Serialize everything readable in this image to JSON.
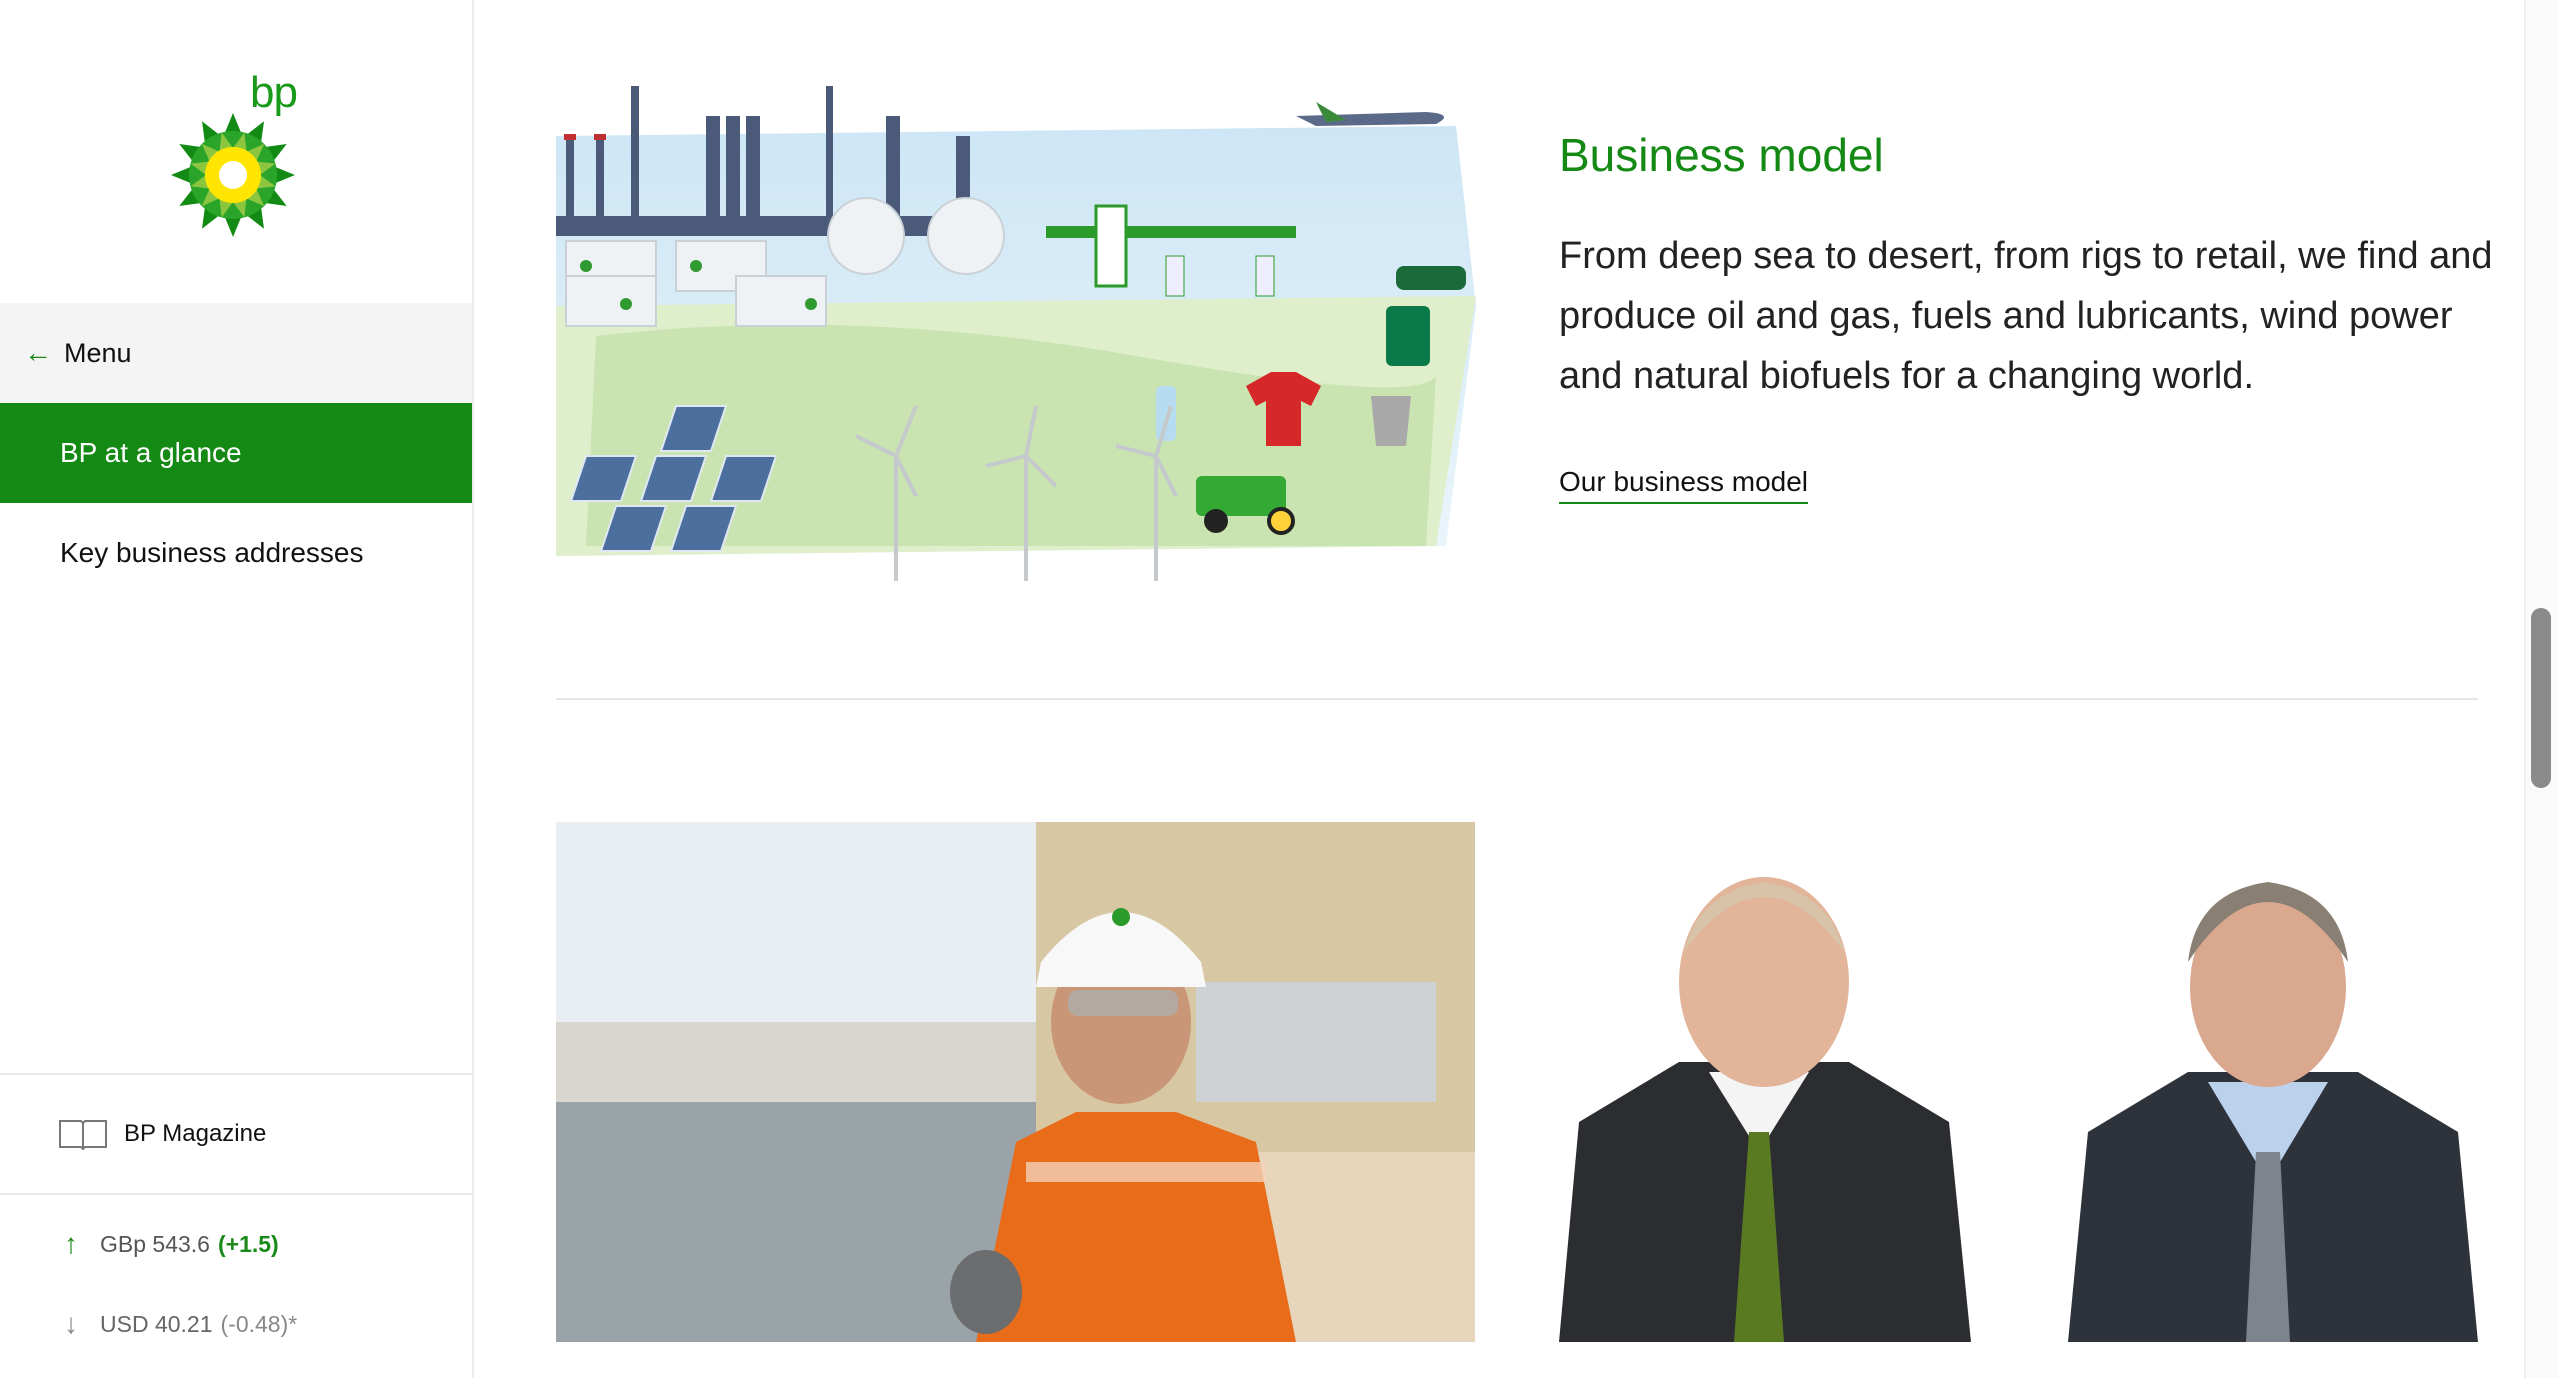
{
  "brand": {
    "logo_text": "bp",
    "green": "#148914",
    "yellow": "#ffe500"
  },
  "sidebar": {
    "back_label": "Menu",
    "items": [
      {
        "label": "BP at a glance",
        "active": true
      },
      {
        "label": "Key business addresses",
        "active": false
      }
    ],
    "magazine_label": "BP Magazine",
    "tickers": [
      {
        "direction": "up",
        "symbol": "GBp",
        "price": "543.6",
        "change": "(+1.5)"
      },
      {
        "direction": "down",
        "symbol": "USD",
        "price": "40.21",
        "change": "(-0.48)*"
      }
    ]
  },
  "main": {
    "section_title": "Business model",
    "section_body": "From deep sea to desert, from rigs to retail, we find and produce oil and gas, fuels and lubricants, wind power and natural biofuels for a changing world.",
    "section_link": "Our business model"
  }
}
